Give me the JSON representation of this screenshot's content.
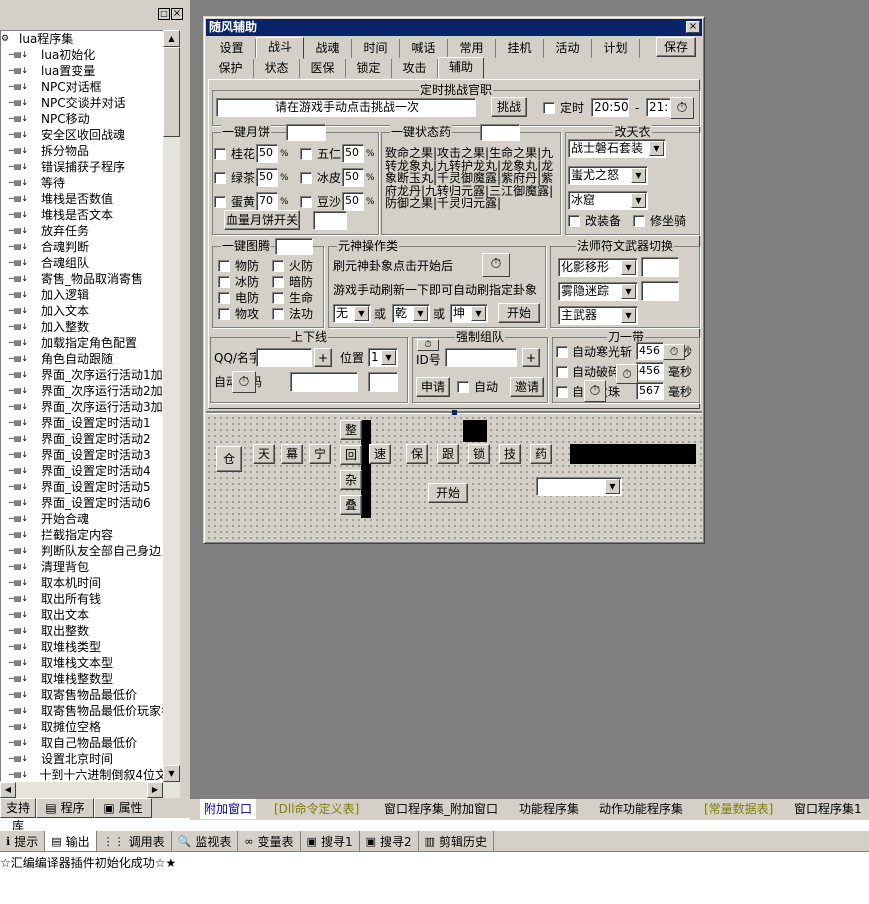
{
  "tree": {
    "root": "lua程序集",
    "items": [
      "lua初始化",
      "lua置变量",
      "NPC对话框",
      "NPC交谈并对话",
      "NPC移动",
      "安全区收回战魂",
      "拆分物品",
      "错误捕获子程序",
      "等待",
      "堆栈是否数值",
      "堆栈是否文本",
      "放弃任务",
      "合魂判断",
      "合魂组队",
      "寄售_物品取消寄售",
      "加入逻辑",
      "加入文本",
      "加入整数",
      "加载指定角色配置",
      "角色自动跟随",
      "界面_次序运行活动1加入",
      "界面_次序运行活动2加入",
      "界面_次序运行活动3加入",
      "界面_设置定时活动1",
      "界面_设置定时活动2",
      "界面_设置定时活动3",
      "界面_设置定时活动4",
      "界面_设置定时活动5",
      "界面_设置定时活动6",
      "开始合魂",
      "拦截指定内容",
      "判断队友全部自己身边",
      "清理背包",
      "取本机时间",
      "取出所有钱",
      "取出文本",
      "取出整数",
      "取堆栈类型",
      "取堆栈文本型",
      "取堆栈整数型",
      "取寄售物品最低价",
      "取寄售物品最低价玩家名",
      "取摊位空格",
      "取自己物品最低价",
      "设置北京时间",
      "十到十六进制倒叙4位文本"
    ],
    "tabs": [
      "支持库",
      "程序",
      "属性"
    ]
  },
  "window": {
    "title": "随风辅助",
    "close": "×",
    "tabs_row1": [
      "设置",
      "战斗",
      "战魂",
      "时间",
      "喊话",
      "常用",
      "挂机",
      "活动",
      "计划"
    ],
    "save": "保存",
    "tabs_row2": [
      "保护",
      "状态",
      "医保",
      "锁定",
      "攻击",
      "辅助"
    ],
    "challenge": {
      "title": "定时挑战官职",
      "hint": "请在游戏手动点击挑战一次",
      "btn": "挑战",
      "timer_label": "定时",
      "time1": "20:50",
      "time2": "21:"
    },
    "mooncake": {
      "title": "一键月饼",
      "items": [
        [
          "桂花",
          "50",
          "%"
        ],
        [
          "五仁",
          "50",
          "%"
        ],
        [
          "绿茶",
          "50",
          "%"
        ],
        [
          "冰皮",
          "50",
          "%"
        ],
        [
          "蛋黄",
          "70",
          "%"
        ],
        [
          "豆沙",
          "50",
          "%"
        ]
      ],
      "btn": "血量月饼开关"
    },
    "status_drug": {
      "title": "一键状态药",
      "text": "致命之果|攻击之果|生命之果|九转龙象丸|九转护龙丸|龙象丸|龙象断玉丸|千灵御魔露|紫府丹|紫府龙丹|九转归元露|三江御魔露|防御之果|千灵归元露|"
    },
    "clothes": {
      "title": "改天衣",
      "combo1": "战士磐石套装",
      "combo2": "蚩尤之怒",
      "combo3": "冰窟",
      "cb1": "改装备",
      "cb2": "修坐骑"
    },
    "totem": {
      "title": "一键图腾",
      "items": [
        "物防",
        "火防",
        "冰防",
        "暗防",
        "电防",
        "生命",
        "物攻",
        "法功"
      ]
    },
    "yuanshen": {
      "title": "元神操作类",
      "line1": "刷元神卦象点击开始后",
      "line2": "游戏手动刷新一下即可自动刷指定卦象",
      "sel1": "无",
      "or1": "或",
      "sel2": "乾",
      "or2": "或",
      "sel3": "坤",
      "btn": "开始"
    },
    "fashi": {
      "title": "法师符文武器切换",
      "combo1": "化影移形",
      "combo2": "雾隐迷踪",
      "combo3": "主武器"
    },
    "offline": {
      "title": "上下线",
      "qq_label": "QQ/名字",
      "plus": "+",
      "pos_label": "位置",
      "pos_value": "1",
      "pwd_label": "自动密码"
    },
    "team": {
      "title": "强制组队",
      "id_label": "ID号",
      "plus": "+",
      "apply": "申请",
      "auto": "自动",
      "invite": "邀请"
    },
    "blade": {
      "title": "刀一带",
      "rows": [
        [
          "自动寒光斩",
          "456",
          "毫秒"
        ],
        [
          "自动破碎",
          "456",
          "毫秒"
        ],
        [
          "自动火珠",
          "567",
          "毫秒"
        ]
      ]
    },
    "designer": {
      "btn_cang": "仓",
      "btns_row": [
        "天",
        "幕",
        "宁"
      ],
      "vbtns": [
        "整",
        "回",
        "杂",
        "叠"
      ],
      "btn_su": "速",
      "btns_right": [
        "保",
        "跟",
        "锁",
        "技",
        "药"
      ],
      "start": "开始"
    }
  },
  "bottom_tabs": [
    "附加窗口",
    "[Dll命令定义表]",
    "窗口程序集_附加窗口",
    "功能程序集",
    "动作功能程序集",
    "[常量数据表]",
    "窗口程序集1"
  ],
  "output_tabs": [
    "提示",
    "输出",
    "调用表",
    "监视表",
    "变量表",
    "搜寻1",
    "搜寻2",
    "剪辑历史"
  ],
  "status_message": "☆汇编编译器插件初始化成功☆★"
}
